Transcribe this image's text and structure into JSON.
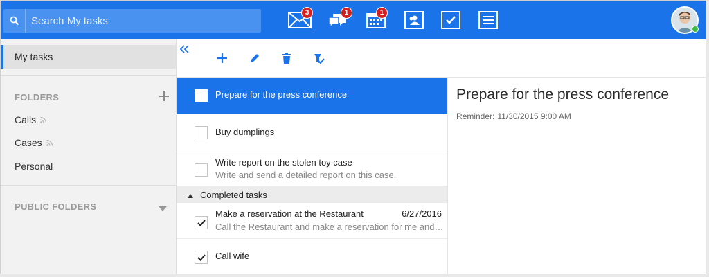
{
  "search": {
    "placeholder": "Search My tasks"
  },
  "nav": {
    "mail_badge": "3",
    "chat_badge": "1",
    "calendar_badge": "1",
    "icons": [
      "mail-icon",
      "chat-icon",
      "calendar-icon",
      "contacts-icon",
      "tasks-icon",
      "notes-icon"
    ]
  },
  "colors": {
    "accent": "#1a73e8",
    "badge": "#d32020",
    "presence": "#3fbf3f"
  },
  "sidebar": {
    "my_tasks": "My tasks",
    "folders_label": "FOLDERS",
    "folders": [
      {
        "label": "Calls",
        "rss": true
      },
      {
        "label": "Cases",
        "rss": true
      },
      {
        "label": "Personal",
        "rss": false
      }
    ],
    "public_folders_label": "PUBLIC FOLDERS"
  },
  "tasks": {
    "items": [
      {
        "title": "Prepare for the press conference",
        "subtitle": "",
        "checked": false,
        "selected": true
      },
      {
        "title": "Buy dumplings",
        "subtitle": "",
        "checked": false,
        "selected": false
      },
      {
        "title": "Write report on the stolen toy case",
        "subtitle": "Write and send a detailed report on this case.",
        "checked": false,
        "selected": false
      }
    ],
    "completed_label": "Completed tasks",
    "completed": [
      {
        "title": "Make a reservation at the Restaurant",
        "date": "6/27/2016",
        "subtitle": "Call the Restaurant and make a reservation for me and…",
        "checked": true
      },
      {
        "title": "Call wife",
        "date": "",
        "subtitle": "",
        "checked": true
      }
    ]
  },
  "detail": {
    "title": "Prepare for the press conference",
    "reminder_label": "Reminder:",
    "reminder_value": "11/30/2015 9:00 AM"
  }
}
